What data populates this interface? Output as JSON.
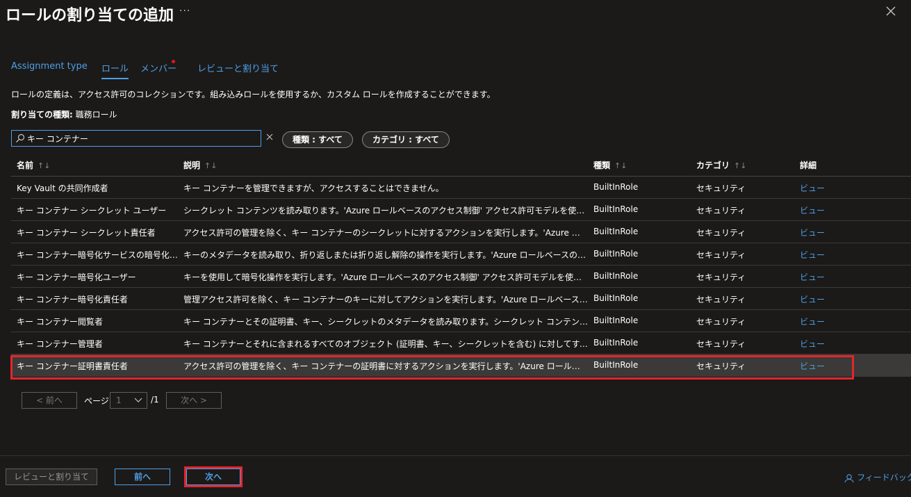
{
  "header": {
    "title": "ロールの割り当ての追加",
    "more": "···",
    "close_icon": "close-icon"
  },
  "tabs": [
    {
      "label": "Assignment type"
    },
    {
      "label": "ロール",
      "active": true
    },
    {
      "label": "メンバー",
      "required": true
    },
    {
      "label": "レビューと割り当て"
    }
  ],
  "description": "ロールの定義は、アクセス許可のコレクションです。組み込みロールを使用するか、カスタム ロールを作成することができます。",
  "assignment_type": {
    "label": "割り当ての種類:",
    "value": "職務ロール"
  },
  "search": {
    "value": "キー コンテナー",
    "placeholder": ""
  },
  "filters": {
    "type": "種類 : すべて",
    "category": "カテゴリ : すべて"
  },
  "table": {
    "headers": {
      "name": "名前",
      "desc": "説明",
      "type": "種類",
      "category": "カテゴリ",
      "detail": "詳細"
    },
    "sort_glyph": "↑↓",
    "rows": [
      {
        "name": "Key Vault の共同作成者",
        "desc": "キー コンテナーを管理できますが、アクセスすることはできません。",
        "type": "BuiltInRole",
        "category": "セキュリティ",
        "detail": "ビュー"
      },
      {
        "name": "キー コンテナー シークレット ユーザー",
        "desc": "シークレット コンテンツを読み取ります。'Azure ロールベースのアクセス制御' アクセス許可モデルを使用するキー コンテナーでのみ機能します。",
        "type": "BuiltInRole",
        "category": "セキュリティ",
        "detail": "ビュー"
      },
      {
        "name": "キー コンテナー シークレット責任者",
        "desc": "アクセス許可の管理を除く、キー コンテナーのシークレットに対するアクションを実行します。'Azure ロールベースのアクセス制御' アクセス許可モデルを使用するキー コンテナーでのみ機能します。",
        "type": "BuiltInRole",
        "category": "セキュリティ",
        "detail": "ビュー"
      },
      {
        "name": "キー コンテナー暗号化サービスの暗号化 (プレビュー)",
        "desc": "キーのメタデータを読み取り、折り返しまたは折り返し解除の操作を実行します。'Azure ロールベースのアクセス制御' アクセス許可モデルを使用するキー コンテナーでのみ機能します。",
        "type": "BuiltInRole",
        "category": "セキュリティ",
        "detail": "ビュー"
      },
      {
        "name": "キー コンテナー暗号化ユーザー",
        "desc": "キーを使用して暗号化操作を実行します。'Azure ロールベースのアクセス制御' アクセス許可モデルを使用するキー コンテナーでのみ機能します。",
        "type": "BuiltInRole",
        "category": "セキュリティ",
        "detail": "ビュー"
      },
      {
        "name": "キー コンテナー暗号化責任者",
        "desc": "管理アクセス許可を除く、キー コンテナーのキーに対してアクションを実行します。'Azure ロールベースのアクセス制御' アクセス許可モデルを使用するキー コンテナーでのみ機能します。",
        "type": "BuiltInRole",
        "category": "セキュリティ",
        "detail": "ビュー"
      },
      {
        "name": "キー コンテナー閲覧者",
        "desc": "キー コンテナーとその証明書、キー、シークレットのメタデータを読み取ります。シークレット コンテンツやキー マテリアルなどの機密値は読み取ることができません。",
        "type": "BuiltInRole",
        "category": "セキュリティ",
        "detail": "ビュー"
      },
      {
        "name": "キー コンテナー管理者",
        "desc": "キー コンテナーとそれに含まれるすべてのオブジェクト (証明書、キー、シークレットを含む) に対してすべてのデータ プレーン操作を実行します。",
        "type": "BuiltInRole",
        "category": "セキュリティ",
        "detail": "ビュー"
      },
      {
        "name": "キー コンテナー証明書責任者",
        "desc": "アクセス許可の管理を除く、キー コンテナーの証明書に対するアクションを実行します。'Azure ロールベースのアクセス制御' アクセス許可モデルを使用するキー コンテナーでのみ機能します。",
        "type": "BuiltInRole",
        "category": "セキュリティ",
        "detail": "ビュー",
        "selected": true
      }
    ]
  },
  "pager": {
    "prev": "< 前へ",
    "page_label": "ページ",
    "page_value": "1",
    "total": "/1",
    "next": "次へ >"
  },
  "footer": {
    "review_assign": "レビューと割り当て",
    "prev": "前へ",
    "next": "次へ",
    "feedback": "フィードバック"
  },
  "colors": {
    "accent": "#4f9fe8",
    "highlight": "#e3262b",
    "background": "#1b1a19"
  }
}
